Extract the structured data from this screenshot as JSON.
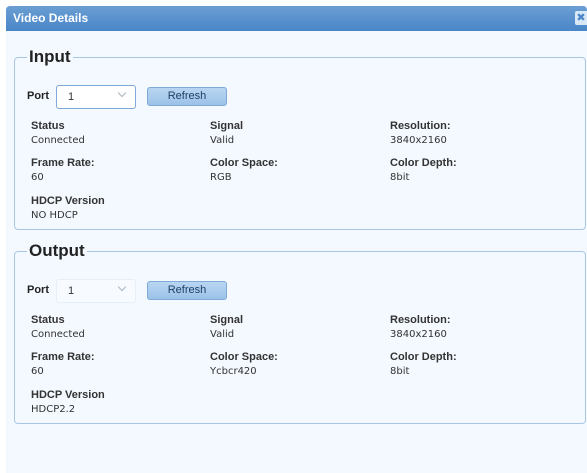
{
  "dialog": {
    "title": "Video Details",
    "close_label": "✖"
  },
  "input": {
    "legend": "Input",
    "port_label": "Port",
    "port_value": "1",
    "refresh_label": "Refresh",
    "fields": {
      "status_label": "Status",
      "status_value": "Connected",
      "signal_label": "Signal",
      "signal_value": "Valid",
      "resolution_label": "Resolution:",
      "resolution_value": "3840x2160",
      "framerate_label": "Frame Rate:",
      "framerate_value": "60",
      "colorspace_label": "Color Space:",
      "colorspace_value": "RGB",
      "colordepth_label": "Color Depth:",
      "colordepth_value": "8bit",
      "hdcp_label": "HDCP Version",
      "hdcp_value": "NO HDCP"
    }
  },
  "output": {
    "legend": "Output",
    "port_label": "Port",
    "port_value": "1",
    "refresh_label": "Refresh",
    "fields": {
      "status_label": "Status",
      "status_value": "Connected",
      "signal_label": "Signal",
      "signal_value": "Valid",
      "resolution_label": "Resolution:",
      "resolution_value": "3840x2160",
      "framerate_label": "Frame Rate:",
      "framerate_value": "60",
      "colorspace_label": "Color Space:",
      "colorspace_value": "Ycbcr420",
      "colordepth_label": "Color Depth:",
      "colordepth_value": "8bit",
      "hdcp_label": "HDCP Version",
      "hdcp_value": "HDCP2.2"
    }
  },
  "colors": {
    "titlebar": "#4a86c8",
    "border": "#a9c6e4",
    "button": "#9cc2e8"
  }
}
